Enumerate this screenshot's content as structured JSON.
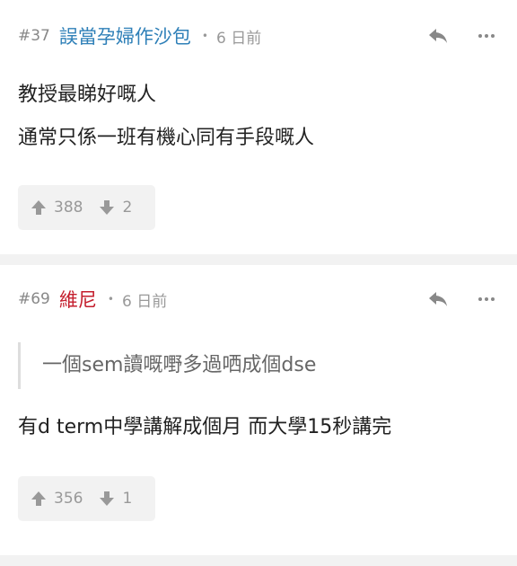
{
  "colors": {
    "user1": "#2f80b8",
    "user2": "#c41d2c",
    "separator": "#f2f2f2"
  },
  "posts": [
    {
      "floor": "#37",
      "username": "誤當孕婦作沙包",
      "dot": "•",
      "time": "6 日前",
      "quote": "",
      "lines": [
        "教授最睇好嘅人",
        "通常只係一班有機心同有手段嘅人"
      ],
      "upvotes": "388",
      "downvotes": "2",
      "icons": {
        "reply": "reply-icon",
        "more": "more-icon",
        "up": "arrow-up-icon",
        "down": "arrow-down-icon"
      }
    },
    {
      "floor": "#69",
      "username": "維尼",
      "dot": "•",
      "time": "6 日前",
      "quote": "一個sem讀嘅嘢多過哂成個dse",
      "lines": [
        "有d term中學講解成個月 而大學15秒講完"
      ],
      "upvotes": "356",
      "downvotes": "1",
      "icons": {
        "reply": "reply-icon",
        "more": "more-icon",
        "up": "arrow-up-icon",
        "down": "arrow-down-icon"
      }
    }
  ]
}
